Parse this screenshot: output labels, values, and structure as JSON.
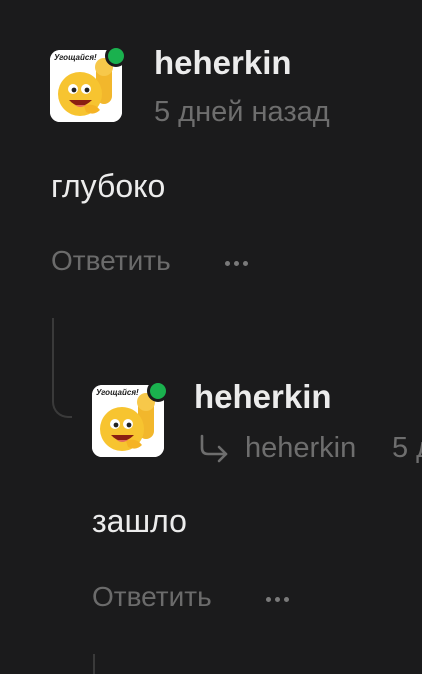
{
  "comments": [
    {
      "avatar": {
        "caption": "Угощайся!",
        "online": true
      },
      "username": "heherkin",
      "timestamp": "5 дней назад",
      "text": "глубоко",
      "reply_label": "Ответить",
      "more_icon": "more-horizontal-icon"
    },
    {
      "avatar": {
        "caption": "Угощайся!",
        "online": true
      },
      "username": "heherkin",
      "reply_to": "heherkin",
      "timestamp_partial": "5 д",
      "text": "зашло",
      "reply_label": "Ответить",
      "more_icon": "more-horizontal-icon"
    }
  ],
  "colors": {
    "background": "#1b1b1c",
    "text": "#ececec",
    "muted": "#6e6e6e",
    "online": "#1ab14e",
    "thread_line": "#3a3a3a"
  }
}
